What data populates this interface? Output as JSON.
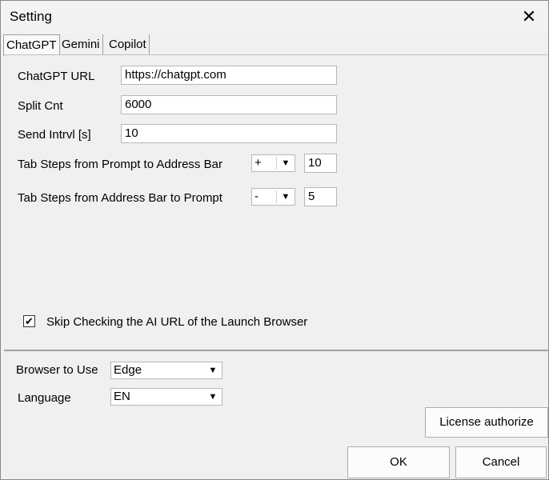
{
  "window": {
    "title": "Setting"
  },
  "tabs": [
    {
      "label": "ChatGPT"
    },
    {
      "label": "Gemini"
    },
    {
      "label": "Copilot"
    }
  ],
  "chatgpt": {
    "url_label": "ChatGPT URL",
    "url_value": "https://chatgpt.com",
    "split_label": "Split Cnt",
    "split_value": "6000",
    "interval_label": "Send Intrvl [s]",
    "interval_value": "10",
    "tab_prompt_to_address_label": "Tab Steps from Prompt to Address Bar",
    "tab_prompt_to_address_sign": "+",
    "tab_prompt_to_address_value": "10",
    "tab_address_to_prompt_label": "Tab Steps from Address Bar to Prompt",
    "tab_address_to_prompt_sign": "-",
    "tab_address_to_prompt_value": "5",
    "skip_check_label": "Skip Checking the AI URL of the Launch Browser",
    "skip_check_mark": "✔"
  },
  "bottom": {
    "browser_label": "Browser to Use",
    "browser_value": "Edge",
    "language_label": "Language",
    "language_value": "EN",
    "license_button": "License authorize",
    "ok_button": "OK",
    "cancel_button": "Cancel"
  },
  "icons": {
    "close": "✕",
    "dropdown": "▼"
  }
}
